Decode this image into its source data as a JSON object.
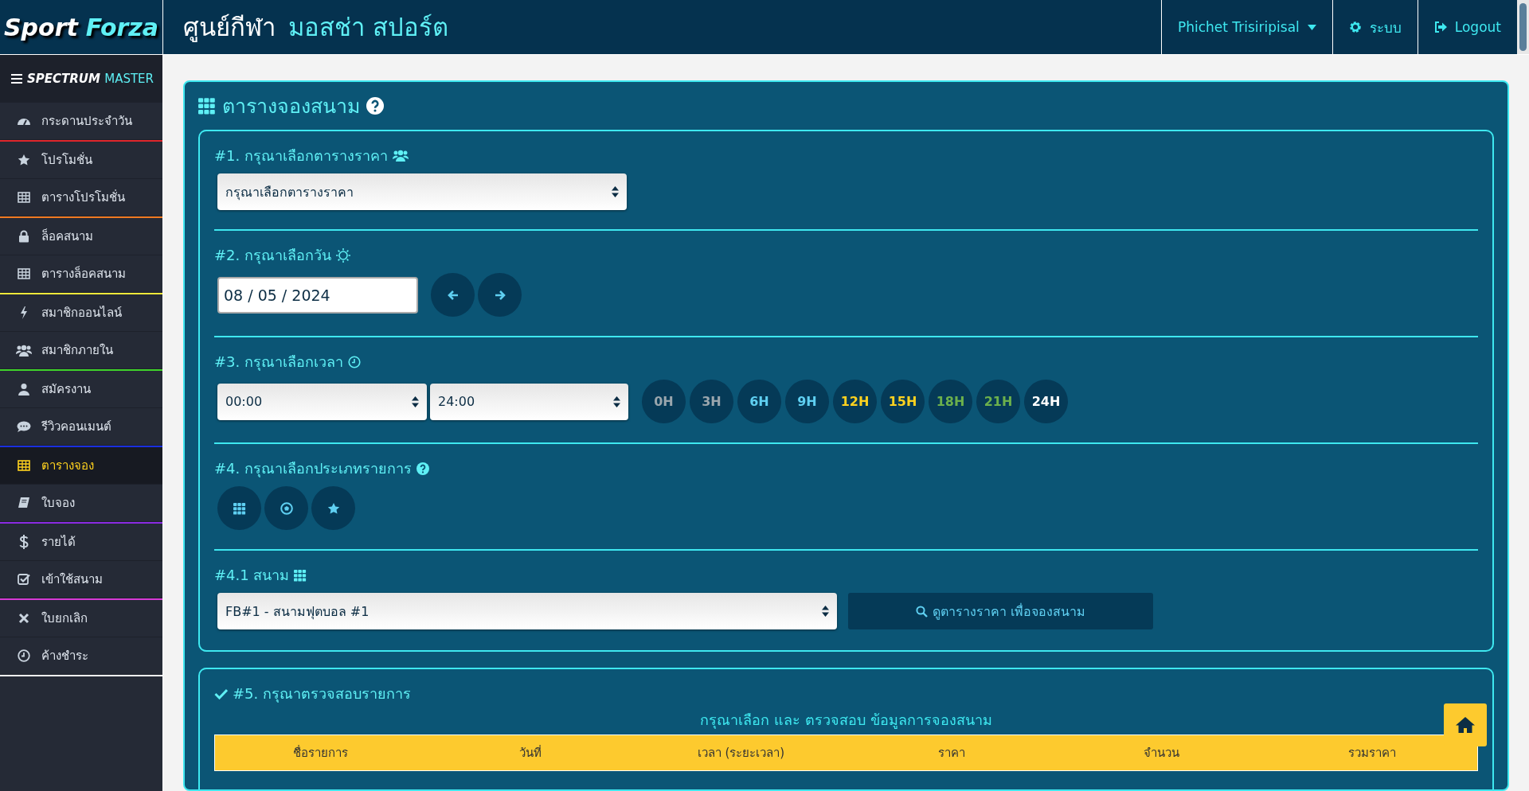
{
  "brand": {
    "first": "Sport",
    "second": "Forza"
  },
  "header": {
    "title": "ศูนย์กีฬา",
    "subtitle": "มอสช่า สปอร์ต",
    "user": "Phichet Trisiripisal",
    "settings": "ระบบ",
    "logout": "Logout"
  },
  "sidebar": {
    "title_first": "SPECTRUM",
    "title_second": "MASTER",
    "groups": [
      {
        "color": "#e0262b",
        "items": [
          {
            "label": "กระดานประจำวัน",
            "selected": false
          }
        ]
      },
      {
        "color": "#f07a22",
        "items": [
          {
            "label": "โปรโมชั่น",
            "selected": false
          },
          {
            "label": "ตารางโปรโมชั่น",
            "selected": false
          }
        ]
      },
      {
        "color": "#f2e93a",
        "items": [
          {
            "label": "ล็อคสนาม",
            "selected": false
          },
          {
            "label": "ตารางล็อคสนาม",
            "selected": false
          }
        ]
      },
      {
        "color": "#3fd42a",
        "items": [
          {
            "label": "สมาชิกออนไลน์",
            "selected": false
          },
          {
            "label": "สมาชิกภายใน",
            "selected": false
          }
        ]
      },
      {
        "color": "#1a2fe0",
        "items": [
          {
            "label": "สมัครงาน",
            "selected": false
          },
          {
            "label": "รีวิวคอนเมนต์",
            "selected": false
          }
        ]
      },
      {
        "color": "#8a2be2",
        "items": [
          {
            "label": "ตารางจอง",
            "selected": true
          },
          {
            "label": "ใบจอง",
            "selected": false
          }
        ]
      },
      {
        "color": "#d63ad6",
        "items": [
          {
            "label": "รายได้",
            "selected": false
          },
          {
            "label": "เข้าใช้สนาม",
            "selected": false
          }
        ]
      },
      {
        "color": "#ffffff",
        "items": [
          {
            "label": "ใบยกเลิก",
            "selected": false
          },
          {
            "label": "ค้างชำระ",
            "selected": false
          }
        ]
      }
    ]
  },
  "panel": {
    "title": "ตารางจองสนาม",
    "price_table": {
      "label": "#1. กรุณาเลือกตารางราคา",
      "value": "กรุณาเลือกตารางราคา"
    },
    "date": {
      "label": "#2. กรุณาเลือกวัน",
      "value": "08 / 05 / 2024"
    },
    "time": {
      "label": "#3. กรุณาเลือกเวลา",
      "start": "00:00",
      "end": "24:00",
      "chips": [
        {
          "label": "0H",
          "color": "#9aa6ad"
        },
        {
          "label": "3H",
          "color": "#9aa6ad"
        },
        {
          "label": "6H",
          "color": "#5fd0f2"
        },
        {
          "label": "9H",
          "color": "#5fd0f2"
        },
        {
          "label": "12H",
          "color": "#ffd21f"
        },
        {
          "label": "15H",
          "color": "#ffd21f"
        },
        {
          "label": "18H",
          "color": "#6cb04c"
        },
        {
          "label": "21H",
          "color": "#6cb04c"
        },
        {
          "label": "24H",
          "color": "#ffffff"
        }
      ]
    },
    "type": {
      "label": "#4. กรุณาเลือกประเภทรายการ"
    },
    "field": {
      "label": "#4.1 สนาม",
      "value": "FB#1 - สนามฟุตบอล #1",
      "button": "ดูตารางราคา เพื่อจองสนาม"
    },
    "review": {
      "label": "#5. กรุณาตรวจสอบรายการ",
      "subtitle": "กรุณาเลือก และ ตรวจสอบ ข้อมูลการจองสนาม",
      "columns": [
        "ชื่อรายการ",
        "วันที่",
        "เวลา (ระยะเวลา)",
        "ราคา",
        "จำนวน",
        "รวมราคา"
      ]
    }
  }
}
